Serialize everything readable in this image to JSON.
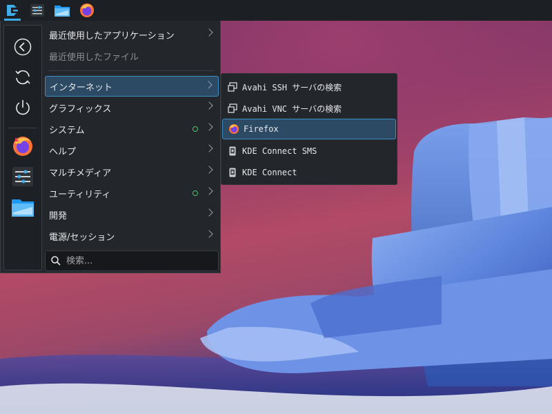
{
  "panel": {
    "launcher_icon": "kde-launcher-icon",
    "items": [
      {
        "name": "settings-icon"
      },
      {
        "name": "file-manager-icon"
      },
      {
        "name": "firefox-icon"
      }
    ]
  },
  "sidebar": {
    "buttons": [
      "back-icon",
      "refresh-icon",
      "power-icon"
    ],
    "favorites": [
      "firefox-icon",
      "system-settings-icon",
      "file-manager-icon"
    ]
  },
  "categories": [
    {
      "label": "最近使用したアプリケーション",
      "dim": false,
      "selected": false,
      "dot": false
    },
    {
      "label": "最近使用したファイル",
      "dim": true,
      "selected": false,
      "dot": false,
      "no_chevron": true
    },
    {
      "label": "インターネット",
      "dim": false,
      "selected": true,
      "dot": false
    },
    {
      "label": "グラフィックス",
      "dim": false,
      "selected": false,
      "dot": false
    },
    {
      "label": "システム",
      "dim": false,
      "selected": false,
      "dot": true
    },
    {
      "label": "ヘルプ",
      "dim": false,
      "selected": false,
      "dot": false
    },
    {
      "label": "マルチメディア",
      "dim": false,
      "selected": false,
      "dot": false
    },
    {
      "label": "ユーティリティ",
      "dim": false,
      "selected": false,
      "dot": true
    },
    {
      "label": "開発",
      "dim": false,
      "selected": false,
      "dot": false
    },
    {
      "label": "電源/セッション",
      "dim": false,
      "selected": false,
      "dot": false
    }
  ],
  "search": {
    "placeholder": "検索..."
  },
  "submenu": [
    {
      "label": "Avahi SSH サーバの検索",
      "icon": "network-browser-icon"
    },
    {
      "label": "Avahi VNC サーバの検索",
      "icon": "network-browser-icon"
    },
    {
      "label": "Firefox",
      "icon": "firefox-icon",
      "selected": true
    },
    {
      "label": "KDE Connect SMS",
      "icon": "kde-connect-icon"
    },
    {
      "label": "KDE Connect",
      "icon": "kde-connect-icon"
    }
  ],
  "colors": {
    "accent": "#3daee9",
    "selection": "#2c4a63",
    "panel": "#1c1f24",
    "menu": "#23262b",
    "dot": "#4fc36d"
  }
}
